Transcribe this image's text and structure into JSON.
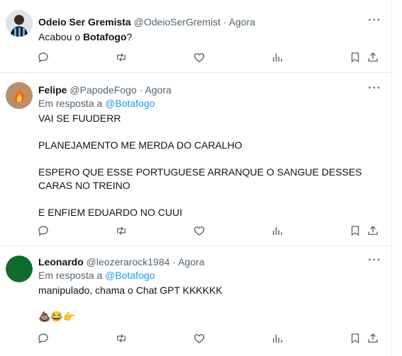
{
  "tweets": [
    {
      "name": "Odeio Ser Gremista",
      "handle": "@OdeioSerGremist",
      "separator": "·",
      "time": "Agora",
      "text_plain": "Acabou o ",
      "text_bold": "Botafogo",
      "text_end": "?",
      "avatar_icon": "player-avatar"
    },
    {
      "name": "Felipe",
      "handle": "@PapodeFogo",
      "separator": "·",
      "time": "Agora",
      "reply_prefix": "Em resposta a",
      "reply_handle": "@Botafogo",
      "lines": [
        "VAI SE FUUDERR",
        "PLANEJAMENTO ME MERDA DO CARALHO",
        "ESPERO QUE ESSE PORTUGUESE ARRANQUE O SANGUE DESSES CARAS NO TREINO",
        "E ENFIEM EDUARDO NO CUUI"
      ],
      "avatar_icon": "fire-avatar"
    },
    {
      "name": "Leonardo",
      "handle": "@leozerarock1984",
      "separator": "·",
      "time": "Agora",
      "reply_prefix": "Em resposta a",
      "reply_handle": "@Botafogo",
      "text": "manipulado, chama o Chat GPT KKKKKK",
      "emojis": "💩😂👉",
      "avatar_icon": "green-avatar"
    }
  ],
  "more_label": "···",
  "icons": [
    "reply-icon",
    "retweet-icon",
    "like-icon",
    "views-icon",
    "bookmark-icon",
    "share-icon"
  ],
  "colors": {
    "accent": "#1d9bf0",
    "muted": "#536471",
    "text": "#0f1419"
  }
}
